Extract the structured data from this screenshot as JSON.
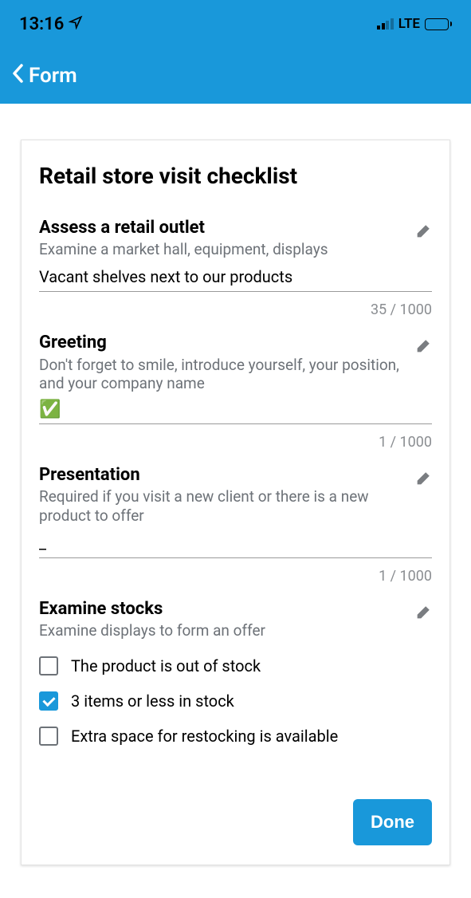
{
  "status": {
    "time": "13:16",
    "network": "LTE"
  },
  "nav": {
    "title": "Form"
  },
  "card": {
    "title": "Retail store visit checklist",
    "sections": [
      {
        "title": "Assess a retail outlet",
        "subtitle": "Examine a market hall, equipment, displays",
        "value": "Vacant shelves next to our products",
        "counter": "35 / 1000"
      },
      {
        "title": "Greeting",
        "subtitle": "Don't forget to smile, introduce yourself, your position, and your company name",
        "value": "✅",
        "counter": "1 / 1000"
      },
      {
        "title": "Presentation",
        "subtitle": "Required if you visit a new client or there is a new product to offer",
        "value": "_",
        "counter": "1 / 1000"
      },
      {
        "title": "Examine stocks",
        "subtitle": "Examine displays to form an offer"
      }
    ],
    "stock_options": [
      {
        "label": "The product is out of stock",
        "checked": false
      },
      {
        "label": "3 items or less in stock",
        "checked": true
      },
      {
        "label": "Extra space for restocking is available",
        "checked": false
      }
    ],
    "done_label": "Done"
  }
}
